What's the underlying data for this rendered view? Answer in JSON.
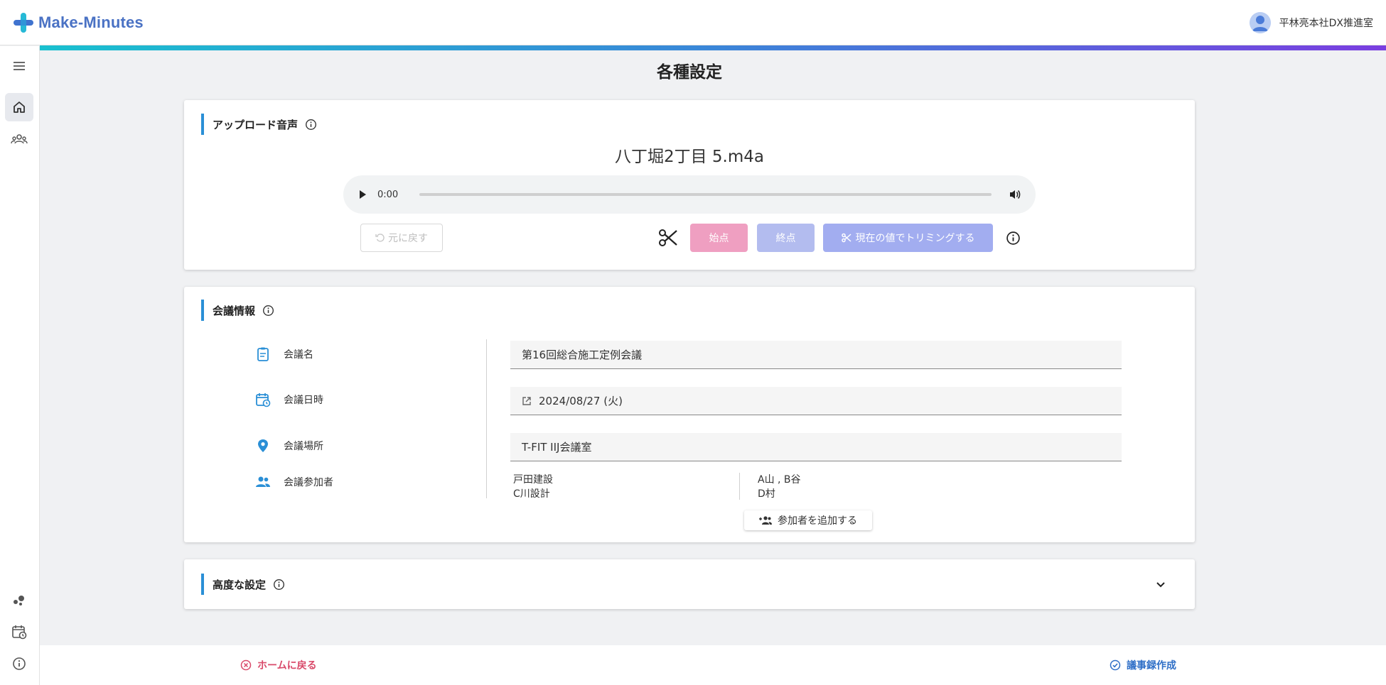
{
  "app": {
    "name": "Make-Minutes",
    "user": "平林亮本社DX推進室"
  },
  "page": {
    "title": "各種設定"
  },
  "upload": {
    "heading": "アップロード音声",
    "file_name": "八丁堀2丁目 5.m4a",
    "current_time": "0:00",
    "reset_label": "元に戻す",
    "start_label": "始点",
    "end_label": "終点",
    "trim_label": "現在の値でトリミングする"
  },
  "meeting": {
    "heading": "会議情報",
    "name_label": "会議名",
    "name_value": "第16回総合施工定例会議",
    "date_label": "会議日時",
    "date_value": "2024/08/27 (火)",
    "place_label": "会議場所",
    "place_value": "T-FIT IIJ会議室",
    "attendees_label": "会議参加者",
    "attendees_left": [
      "戸田建設",
      "C川設計"
    ],
    "attendees_right": [
      "A山 , B谷",
      "D村"
    ],
    "add_attendee_label": "参加者を追加する"
  },
  "advanced": {
    "heading": "高度な設定"
  },
  "footer": {
    "home_label": "ホームに戻る",
    "create_label": "議事録作成"
  },
  "colors": {
    "accent": "#2a8fd6",
    "start": "#ef9fc1",
    "end": "#b3bcef",
    "trim": "#a2adf0",
    "home": "#d94a6a",
    "create": "#2f6fc7"
  }
}
